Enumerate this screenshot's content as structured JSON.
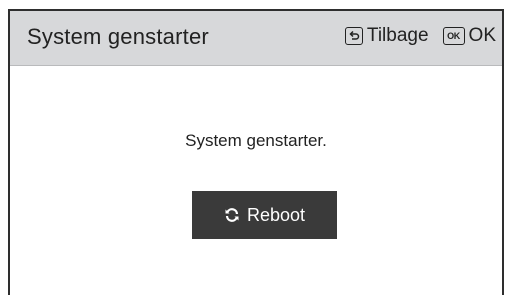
{
  "header": {
    "title": "System genstarter",
    "back_label": "Tilbage",
    "ok_icon_text": "OK",
    "ok_label": "OK"
  },
  "main": {
    "message": "System genstarter.",
    "reboot_label": "Reboot"
  },
  "icons": {
    "back": "return-arrow-icon",
    "ok": "ok-key-icon",
    "reboot": "refresh-icon"
  },
  "colors": {
    "header_bg": "#d7d8da",
    "button_bg": "#3a3a3a",
    "button_text": "#ffffff",
    "frame_border": "#2e2e2e"
  }
}
